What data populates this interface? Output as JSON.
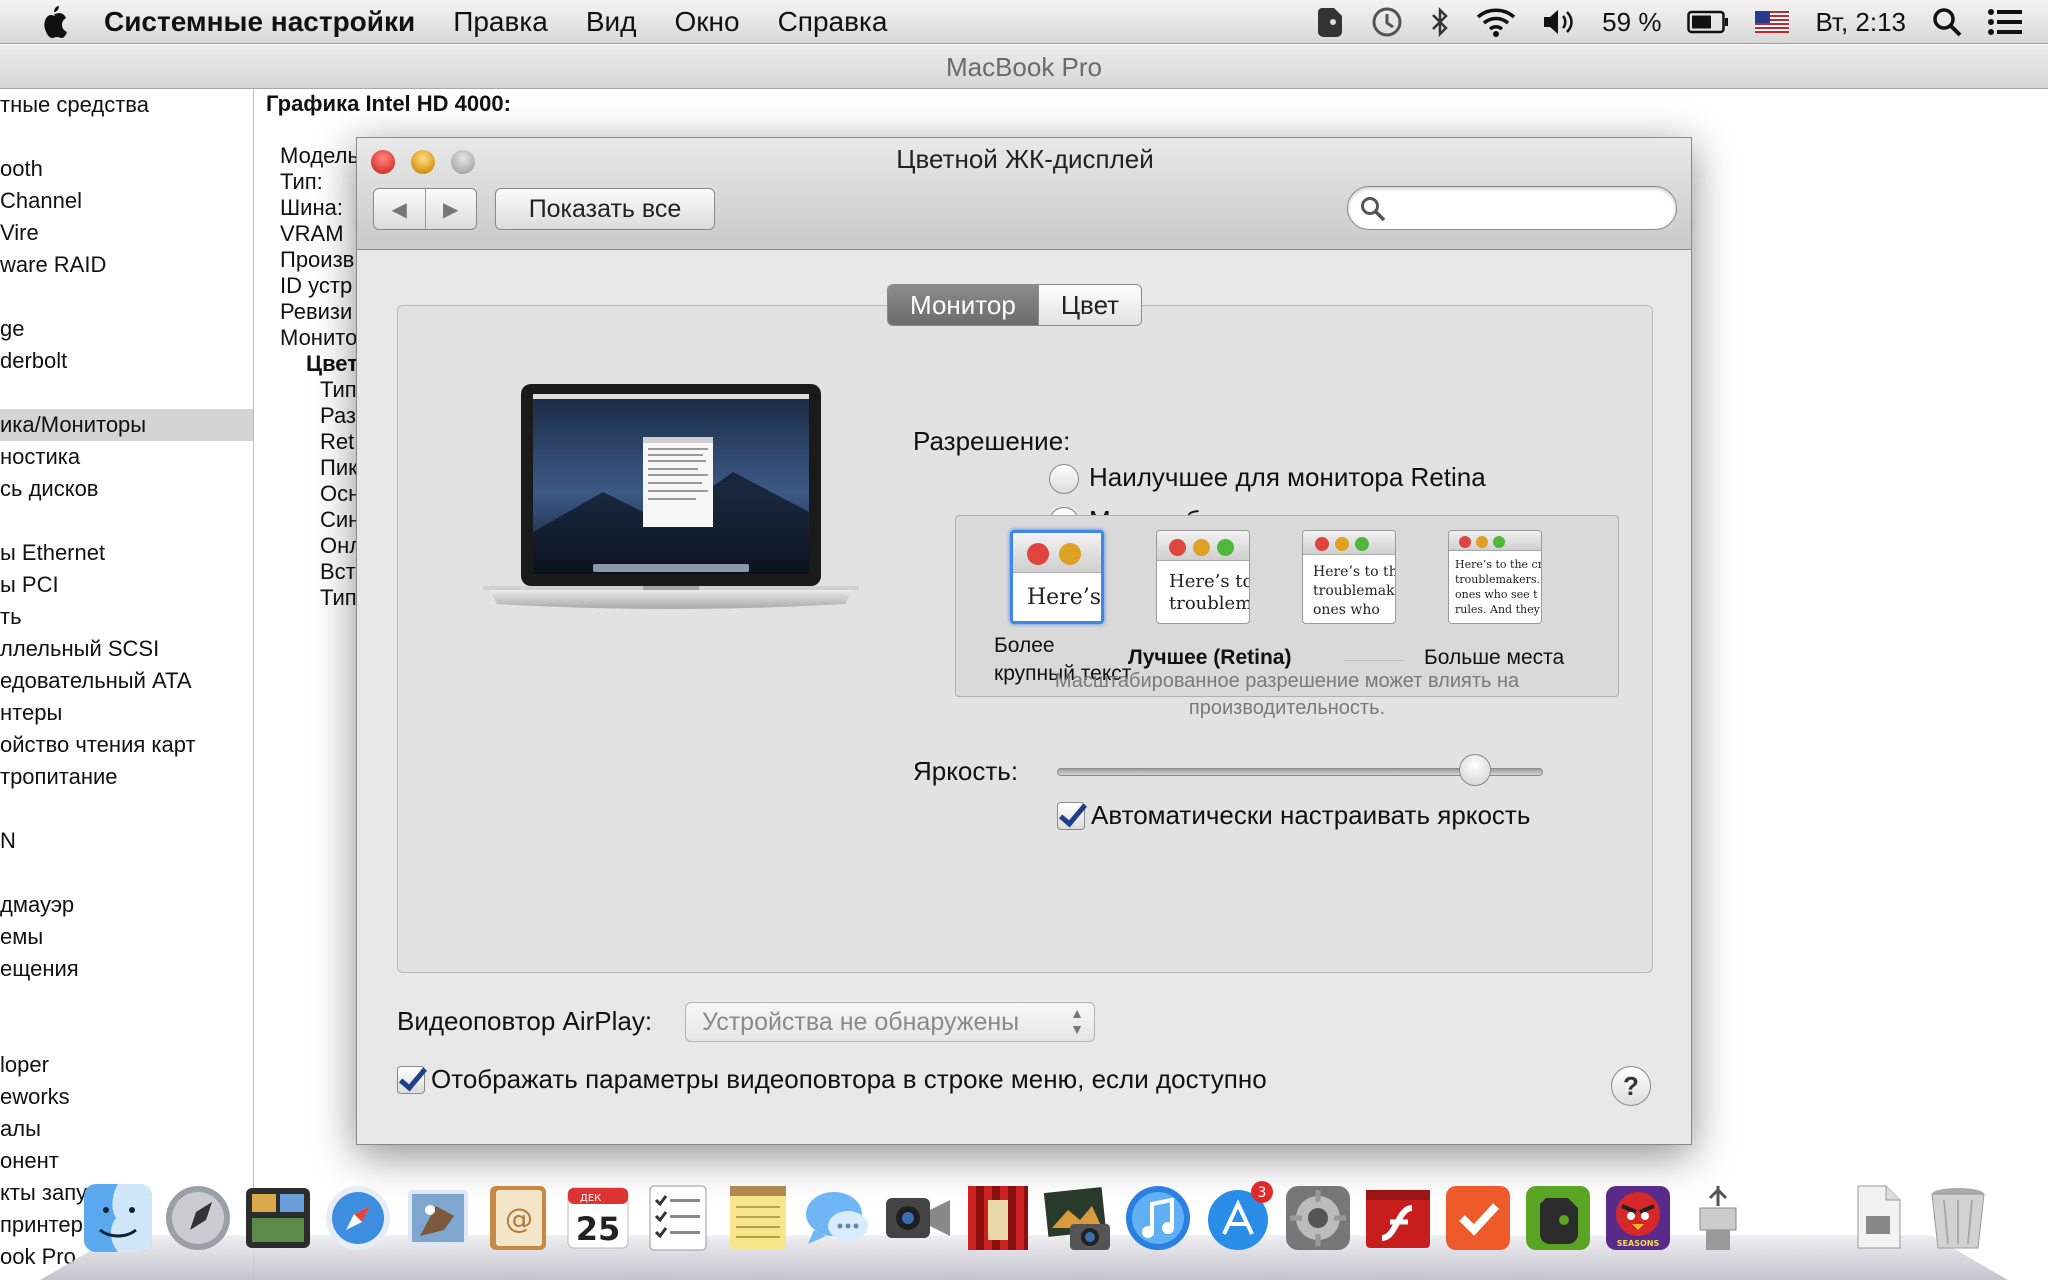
{
  "menubar": {
    "app_name": "Системные настройки",
    "items": [
      "Правка",
      "Вид",
      "Окно",
      "Справка"
    ],
    "battery": "59 %",
    "clock": "Вт, 2:13"
  },
  "bg_window": {
    "title": "MacBook Pro",
    "sidebar_items": [
      "тные средства",
      "ooth",
      " Channel",
      "Vire",
      "ware RAID",
      "ge",
      "derbolt",
      "ика/Мониторы",
      "ностика",
      "сь дисков",
      "ы Ethernet",
      "ы PCI",
      "ть",
      "ллельный SCSI",
      "едовательный ATA",
      "нтеры",
      "ойство чтения карт",
      "тропитание",
      "N",
      "дмауэр",
      "емы",
      "ещения",
      "loper",
      "eworks",
      "алы",
      "онент",
      "кты запуска",
      "принтеры",
      "ook Pro"
    ],
    "content_heading": "Графика Intel HD 4000:",
    "content_lines": [
      "Модель",
      "Тип:",
      "Шина:",
      "VRAM",
      "Произв",
      "ID устр",
      "Ревизи",
      "Монито"
    ],
    "content_sub_heading": "Цвет",
    "content_sub_lines": [
      "Тип",
      "Раз",
      "Ret",
      "Пик",
      "Осн",
      "Син",
      "Онл",
      "Вст",
      "Тип"
    ]
  },
  "pref_window": {
    "title": "Цветной ЖК-дисплей",
    "show_all": "Показать все",
    "search_placeholder": "",
    "tabs": [
      "Монитор",
      "Цвет"
    ],
    "resolution_label": "Разрешение:",
    "options": {
      "retina": "Наилучшее для монитора Retina",
      "scaled": "Масштабировано"
    },
    "selected_option": "scaled",
    "scaling": {
      "thumbs": [
        {
          "text": "Here’s"
        },
        {
          "text": "Here’s to\ntroublem"
        },
        {
          "text": "Here’s to th\ntroublemak\nones who"
        },
        {
          "text": "Here’s to the cr\ntroublemakers.\nones who see t\nrules. And they"
        }
      ],
      "caption_larger": "Более\nкрупный текст",
      "caption_best": "Лучшее (Retina)",
      "caption_more_space": "Больше места",
      "note": "Масштабированное разрешение может влиять на производительность."
    },
    "brightness_label": "Яркость:",
    "brightness_level": 0.86,
    "auto_brightness_label": "Автоматически настраивать яркость",
    "auto_brightness_checked": true,
    "airplay_label": "Видеоповтор AirPlay:",
    "airplay_value": "Устройства не обнаружены",
    "show_mirroring_label": "Отображать параметры видеоповтора в строке меню, если доступно",
    "show_mirroring_checked": true,
    "help": "?"
  },
  "dock": {
    "calendar_day": "25",
    "calendar_month": "ДЕК",
    "appstore_badge": "3",
    "angry_birds_text": "SEASONS"
  },
  "colors": {
    "close": "#e0443e",
    "minimize": "#dea123",
    "zoom_inactive": "#b5b5b5",
    "checkbox_mark": "#1f3e8c"
  }
}
